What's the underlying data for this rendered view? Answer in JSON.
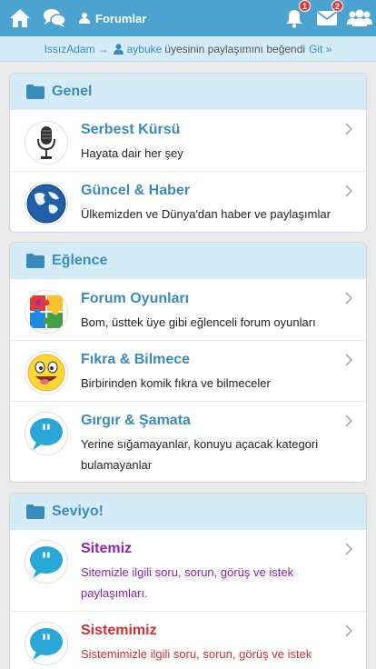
{
  "topbar": {
    "forums_label": "Forumlar",
    "notifications_count": "1",
    "messages_count": "2"
  },
  "activity": {
    "actor": "IssızAdam",
    "arrow": "→",
    "target": "aybuke",
    "text": "üyesinin paylaşımını beğendi",
    "link": "Git »"
  },
  "sections": [
    {
      "title": "Genel",
      "items": [
        {
          "name": "Serbest Kürsü",
          "desc": "Hayata dair her şey",
          "icon": "microphone-icon"
        },
        {
          "name": "Güncel & Haber",
          "desc": "Ülkemizden ve Dünya'dan haber ve paylaşımlar",
          "icon": "globe-icon"
        }
      ]
    },
    {
      "title": "Eğlence",
      "items": [
        {
          "name": "Forum Oyunları",
          "desc": "Bom, üsttek üye gibi eğlenceli forum oyunları",
          "icon": "puzzle-icon"
        },
        {
          "name": "Fıkra & Bilmece",
          "desc": "Birbirinden komik fıkra ve bilmeceler",
          "icon": "laughing-emoji-icon"
        },
        {
          "name": "Gırgır & Şamata",
          "desc": "Yerine sığamayanlar, konuyu açacak kategori bulamayanlar",
          "icon": "speech-bubble-icon"
        }
      ]
    },
    {
      "title": "Seviyo!",
      "items": [
        {
          "name": "Sitemiz",
          "desc": "Sitemizle ilgili soru, sorun, görüş ve istek paylaşımları.",
          "icon": "speech-bubble-icon",
          "color": "#8e24aa"
        },
        {
          "name": "Sistemimiz",
          "desc": "Sistemimizle ilgili soru, sorun, görüş ve istek",
          "icon": "speech-bubble-icon",
          "color": "#d32f2f"
        }
      ]
    }
  ],
  "colors": {
    "accent": "#4aa4cf",
    "link": "#3a8bbd",
    "section_header_bg": "#d5ecf7",
    "badge": "#e53935"
  }
}
